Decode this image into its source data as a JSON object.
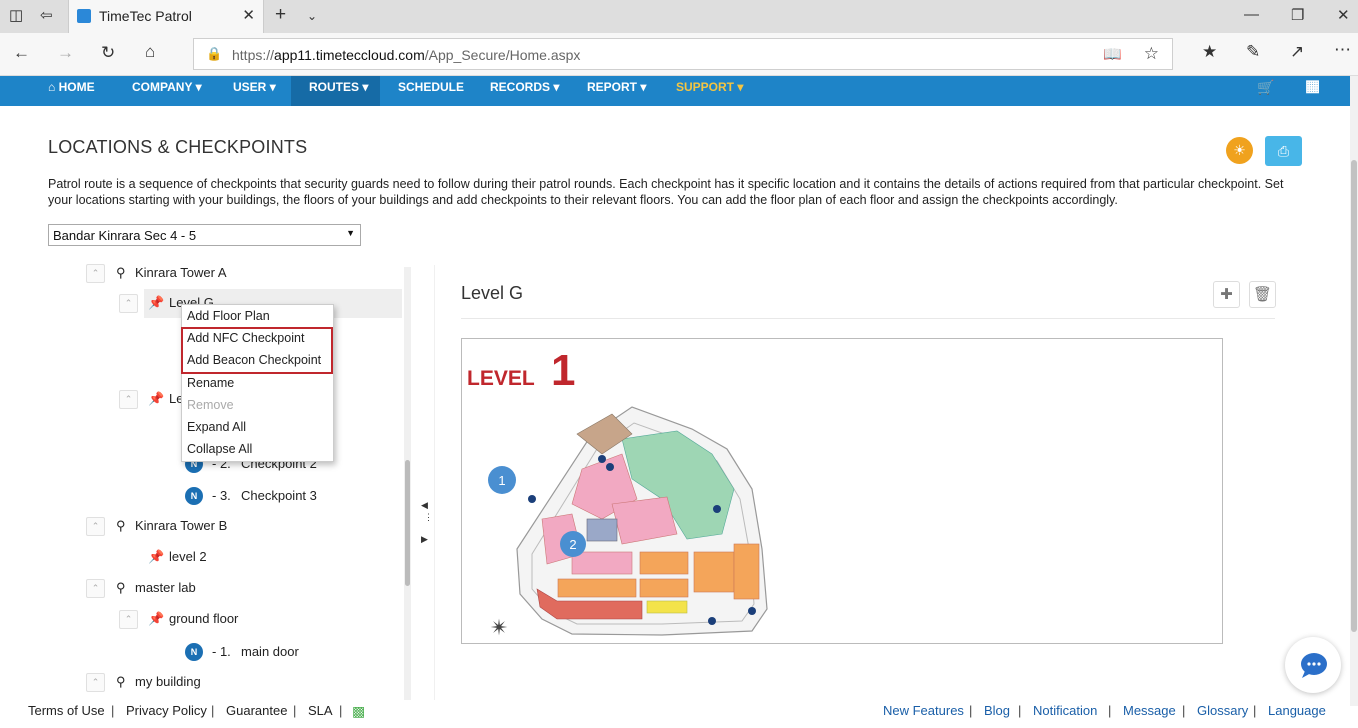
{
  "browser": {
    "tab_title": "TimeTec Patrol",
    "url_prefix": "https://",
    "url_host": "app11.timeteccloud.com",
    "url_path": "/App_Secure/Home.aspx"
  },
  "nav": {
    "items": [
      "HOME",
      "COMPANY",
      "USER",
      "ROUTES",
      "SCHEDULE",
      "RECORDS",
      "REPORT",
      "SUPPORT"
    ],
    "active": "ROUTES",
    "brand_color": "#1e84c8"
  },
  "page": {
    "title": "LOCATIONS & CHECKPOINTS",
    "description": "Patrol route is a sequence of checkpoints that security guards need to follow during their patrol rounds. Each checkpoint has it specific location and it contains the details of actions required from that particular checkpoint. Set your locations starting with your buildings, the floors of your buildings and add checkpoints to their relevant floors. You can add the floor plan of each floor and assign the checkpoints accordingly.",
    "location_select": "Bandar Kinrara Sec 4 - 5"
  },
  "tree": {
    "kinrara_a": "Kinrara Tower A",
    "level_g": "Level G",
    "level_partial": "Lev",
    "cp2_num": "-  2.",
    "cp2_name": "Checkpoint 2",
    "cp3_num": "-  3.",
    "cp3_name": "Checkpoint 3",
    "kinrara_b": "Kinrara Tower B",
    "level2": "level 2",
    "master_lab": "master lab",
    "ground_floor": "ground floor",
    "cp1_num": "-  1.",
    "cp1_name": "main door",
    "my_building": "my building"
  },
  "context_menu": {
    "add_floor_plan": "Add Floor Plan",
    "add_nfc": "Add NFC Checkpoint",
    "add_beacon": "Add Beacon Checkpoint",
    "rename": "Rename",
    "remove": "Remove",
    "expand_all": "Expand All",
    "collapse_all": "Collapse All",
    "highlight_color": "#c0272d"
  },
  "detail": {
    "title": "Level G",
    "floor_label": "LEVEL",
    "floor_number": "1",
    "marker1": "1",
    "marker2": "2"
  },
  "footer": {
    "left": [
      "Terms of Use",
      "Privacy Policy",
      "Guarantee",
      "SLA"
    ],
    "right": [
      "New Features",
      "Blog",
      "Notification",
      "Message",
      "Glossary",
      "Language"
    ]
  }
}
